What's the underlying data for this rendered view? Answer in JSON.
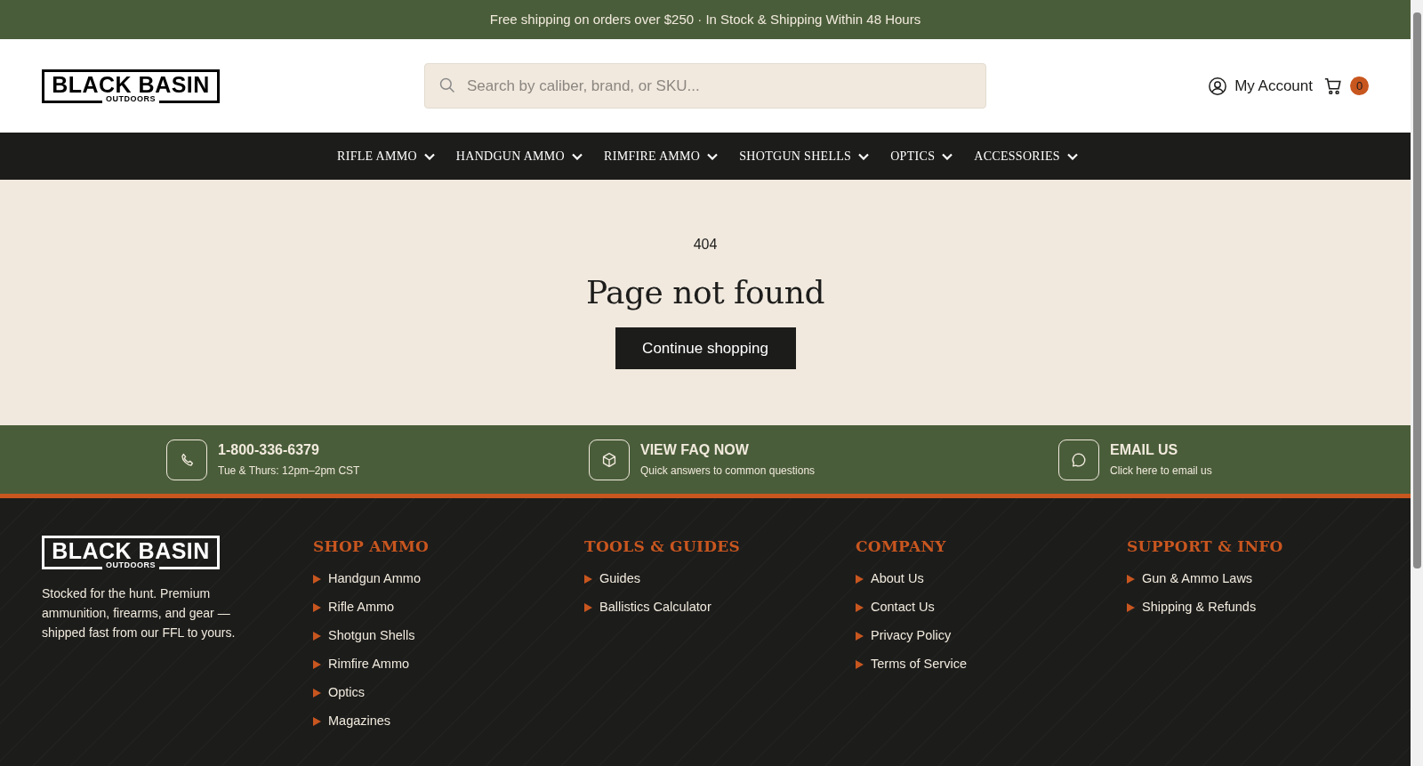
{
  "announcement": "Free shipping on orders over $250 · In Stock & Shipping Within 48 Hours",
  "header": {
    "logo": {
      "name": "BLACK BASIN",
      "tagline": "OUTDOORS"
    },
    "search": {
      "placeholder": "Search by caliber, brand, or SKU..."
    },
    "account": "My Account",
    "cart_count": "0"
  },
  "nav": [
    {
      "label": "RIFLE AMMO"
    },
    {
      "label": "HANDGUN AMMO"
    },
    {
      "label": "RIMFIRE AMMO"
    },
    {
      "label": "SHOTGUN SHELLS"
    },
    {
      "label": "OPTICS"
    },
    {
      "label": "ACCESSORIES"
    }
  ],
  "error": {
    "code": "404",
    "title": "Page not found",
    "button": "Continue shopping"
  },
  "contact": [
    {
      "kind": "phone",
      "title": "1-800-336-6379",
      "subtitle": "Tue & Thurs: 12pm–2pm CST"
    },
    {
      "kind": "faq",
      "title": "VIEW FAQ NOW",
      "subtitle": "Quick answers to common questions"
    },
    {
      "kind": "email",
      "title": "EMAIL US",
      "subtitle": "Click here to email us"
    }
  ],
  "footer": {
    "logo": {
      "name": "BLACK BASIN",
      "tagline": "OUTDOORS"
    },
    "blurb": "Stocked for the hunt. Premium ammunition, firearms, and gear — shipped fast from our FFL to yours.",
    "columns": [
      {
        "title": "SHOP AMMO",
        "links": [
          "Handgun Ammo",
          "Rifle Ammo",
          "Shotgun Shells",
          "Rimfire Ammo",
          "Optics",
          "Magazines"
        ]
      },
      {
        "title": "TOOLS & GUIDES",
        "links": [
          "Guides",
          "Ballistics Calculator"
        ]
      },
      {
        "title": "COMPANY",
        "links": [
          "About Us",
          "Contact Us",
          "Privacy Policy",
          "Terms of Service"
        ]
      },
      {
        "title": "SUPPORT & INFO",
        "links": [
          "Gun & Ammo Laws",
          "Shipping & Refunds"
        ]
      }
    ]
  }
}
